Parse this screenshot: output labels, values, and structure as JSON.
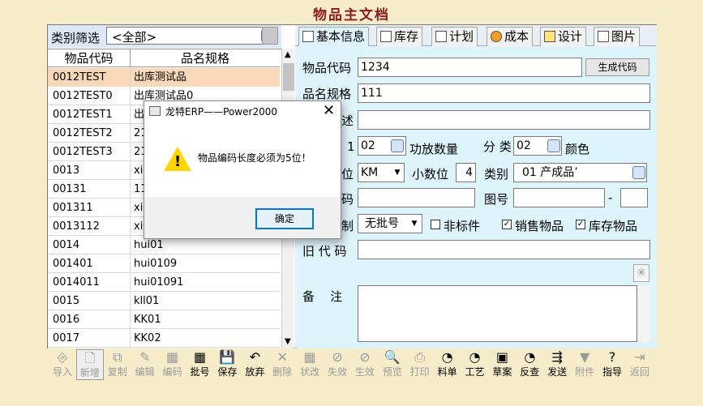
{
  "page": {
    "title": "物品主文档"
  },
  "filter": {
    "label": "类别筛选",
    "value": "<全部>"
  },
  "grid": {
    "headers": [
      "物品代码",
      "品名规格"
    ],
    "rows": [
      {
        "code": "0012TEST",
        "name": "出库测试品",
        "selected": true
      },
      {
        "code": "0012TEST0",
        "name": "出库测试品0"
      },
      {
        "code": "0012TEST1",
        "name": "出"
      },
      {
        "code": "0012TEST2",
        "name": "21"
      },
      {
        "code": "0012TEST3",
        "name": "21"
      },
      {
        "code": "0013",
        "name": "xi"
      },
      {
        "code": "00131",
        "name": "11"
      },
      {
        "code": "001311",
        "name": "xi"
      },
      {
        "code": "0013112",
        "name": "xi"
      },
      {
        "code": "0014",
        "name": "hui01"
      },
      {
        "code": "001401",
        "name": "hui0109"
      },
      {
        "code": "0014011",
        "name": "hui01091"
      },
      {
        "code": "0015",
        "name": "kll01"
      },
      {
        "code": "0016",
        "name": "KK01"
      },
      {
        "code": "0017",
        "name": "KK02"
      }
    ]
  },
  "tabs": [
    {
      "label": "基本信息",
      "icon": "document-icon",
      "active": true
    },
    {
      "label": "库存",
      "icon": "inventory-icon"
    },
    {
      "label": "计划",
      "icon": "chart-icon"
    },
    {
      "label": "成本",
      "icon": "target-icon"
    },
    {
      "label": "设计",
      "icon": "folder-icon"
    },
    {
      "label": "图片",
      "icon": "picture-icon"
    }
  ],
  "form": {
    "code_label": "物品代码",
    "code_value": "1234",
    "gen_button": "生成代码",
    "name_label": "品名规格",
    "name_value": "111",
    "desc_label_partial": "述",
    "class1_label_partial": "1",
    "class1_value": "02",
    "gongfang_label": "功放数量",
    "class2_label": "分 类 2",
    "class2_value": "02",
    "color_label": "颜色",
    "unit_label_partial": "位",
    "unit_value": "KM",
    "decimal_label": "小数位",
    "decimal_value": "4",
    "category_label": "类别",
    "category_value": "01 产成品’",
    "code2_label_partial": "码",
    "drawing_label": "图号",
    "drawing_sep": "-",
    "batch_label_partial": "制",
    "batch_value": "无批号",
    "nonstd_label": "非标件",
    "nonstd_checked": false,
    "sales_label": "销售物品",
    "sales_checked": true,
    "stock_label": "库存物品",
    "stock_checked": true,
    "oldcode_label": "旧 代 码",
    "remark_label": "备    注"
  },
  "toolbar": [
    {
      "label": "导入",
      "icon": "import-icon",
      "disabled": true
    },
    {
      "label": "新增",
      "icon": "new-document-icon",
      "disabled": true,
      "pressed": true
    },
    {
      "label": "复制",
      "icon": "copy-icon",
      "disabled": true
    },
    {
      "label": "编辑",
      "icon": "edit-icon",
      "disabled": true
    },
    {
      "label": "编码",
      "icon": "code-icon",
      "disabled": true
    },
    {
      "label": "批号",
      "icon": "batch-icon",
      "disabled": false
    },
    {
      "label": "保存",
      "icon": "save-icon",
      "disabled": false
    },
    {
      "label": "放弃",
      "icon": "undo-icon",
      "disabled": false
    },
    {
      "label": "删除",
      "icon": "delete-icon",
      "disabled": true
    },
    {
      "label": "状改",
      "icon": "status-icon",
      "disabled": true
    },
    {
      "label": "失效",
      "icon": "invalid-icon",
      "disabled": true
    },
    {
      "label": "生效",
      "icon": "valid-icon",
      "disabled": true
    },
    {
      "label": "预览",
      "icon": "preview-icon",
      "disabled": true
    },
    {
      "label": "打印",
      "icon": "print-icon",
      "disabled": true
    },
    {
      "label": "料单",
      "icon": "bom-icon",
      "disabled": false
    },
    {
      "label": "工艺",
      "icon": "process-icon",
      "disabled": false
    },
    {
      "label": "草案",
      "icon": "draft-icon",
      "disabled": false
    },
    {
      "label": "反查",
      "icon": "reverse-lookup-icon",
      "disabled": false
    },
    {
      "label": "发送",
      "icon": "send-icon",
      "disabled": false
    },
    {
      "label": "附件",
      "icon": "filter-icon",
      "disabled": true
    },
    {
      "label": "指导",
      "icon": "help-icon",
      "disabled": false
    },
    {
      "label": "返回",
      "icon": "exit-icon",
      "disabled": true
    }
  ],
  "dialog": {
    "title": "龙特ERP——Power2000",
    "message": "物品编码长度必须为5位！",
    "ok_label": "确定"
  },
  "colors": {
    "background": "#f7ecc9",
    "panel": "#ddf4fb",
    "selected_row": "#f9d7b9",
    "title": "#8b1a1a"
  }
}
